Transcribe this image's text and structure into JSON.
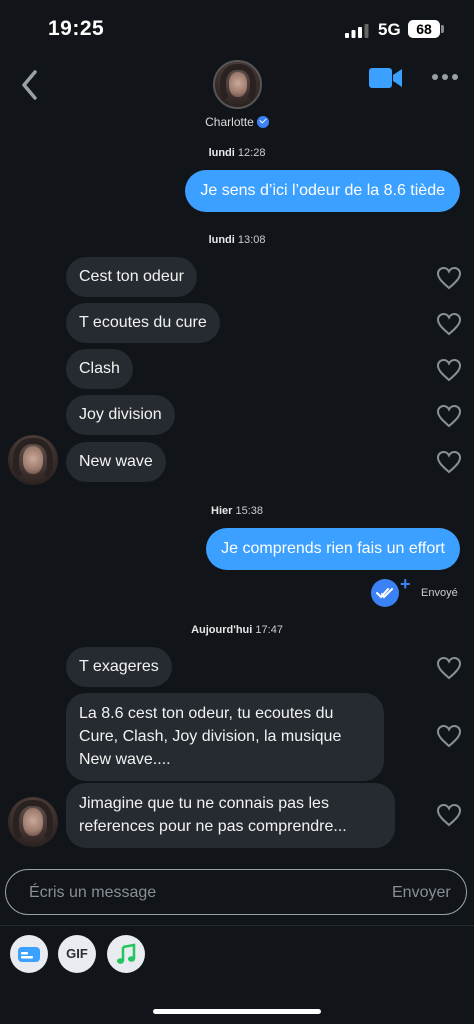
{
  "status_bar": {
    "time": "19:25",
    "network": "5G",
    "battery": "68"
  },
  "header": {
    "contact_name": "Charlotte"
  },
  "messages": {
    "date1": {
      "day": "lundi",
      "time": "12:28"
    },
    "m1": "Je sens d’ici l’odeur de la 8.6 tiède",
    "date2": {
      "day": "lundi",
      "time": "13:08"
    },
    "m2": "Cest ton odeur",
    "m3": "T ecoutes du cure",
    "m4": "Clash",
    "m5": "Joy division",
    "m6": "New wave",
    "date3": {
      "day": "Hier",
      "time": "15:38"
    },
    "m7": "Je comprends rien fais un effort",
    "sent_status": "Envoyé",
    "date4": {
      "day": "Aujourd'hui",
      "time": "17:47"
    },
    "m8": "T exageres",
    "m9": [
      "La 8.6 cest ton odeur, tu ecoutes du",
      "Cure, Clash, Joy division, la musique",
      "New wave...."
    ],
    "m10": [
      "Jimagine que tu ne connais pas les",
      "references pour ne pas comprendre..."
    ]
  },
  "composer": {
    "placeholder": "Écris un message",
    "send_label": "Envoyer"
  },
  "toolbar": {
    "gif_label": "GIF"
  },
  "colors": {
    "background": "#111418",
    "sent_bubble": "#3ba0ff",
    "received_bubble": "#262a31",
    "accent": "#3b82f6"
  },
  "icons": [
    "back-chevron-icon",
    "video-call-icon",
    "more-icon",
    "heart-icon",
    "verified-icon",
    "read-receipt-icon",
    "contact-card-icon",
    "music-note-icon"
  ]
}
